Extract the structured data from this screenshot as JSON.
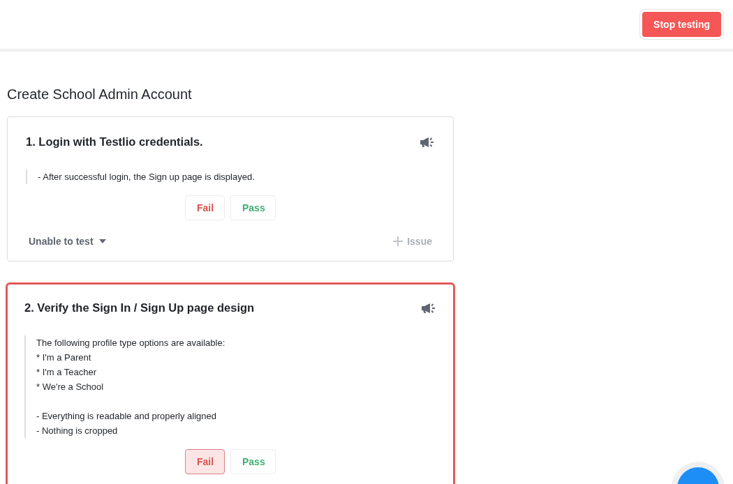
{
  "header": {
    "stop_button": "Stop testing"
  },
  "section_title": "Create School Admin Account",
  "steps": [
    {
      "title": "1. Login with Testlio credentials.",
      "groups": [
        [
          "- After successful login, the Sign up page is displayed."
        ]
      ],
      "buttons": [
        {
          "kind": "fail",
          "label": "Fail",
          "selected": false
        },
        {
          "kind": "pass",
          "label": "Pass",
          "selected": false
        }
      ],
      "footer": {
        "unable_label": "Unable to test",
        "issue_label": "Issue"
      }
    },
    {
      "title": "2. Verify the Sign In / Sign Up page design",
      "groups": [
        [
          "The following profile type options are available:",
          "* I'm a Parent",
          "* I'm a Teacher",
          "* We're a School"
        ],
        [
          "- Everything is readable and properly aligned",
          "- Nothing is cropped"
        ]
      ],
      "buttons": [
        {
          "kind": "fail",
          "label": "Fail",
          "selected": true
        },
        {
          "kind": "pass",
          "label": "Pass",
          "selected": false
        }
      ]
    }
  ]
}
